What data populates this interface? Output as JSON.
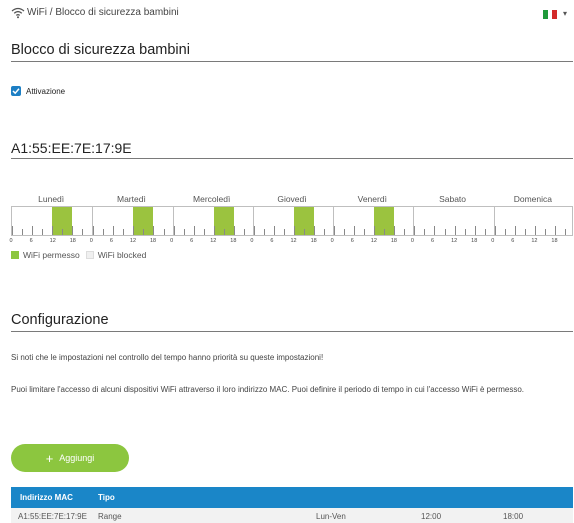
{
  "breadcrumb": {
    "wifi": "WiFi",
    "separator": "/",
    "page": "Blocco di sicurezza bambini"
  },
  "language": {
    "icon": "italy-flag-icon",
    "caret": "▾"
  },
  "section_title": "Blocco di sicurezza bambini",
  "activation": {
    "label": "Attivazione",
    "checked": true
  },
  "device": {
    "mac": "A1:55:EE:7E:17:9E"
  },
  "schedule": {
    "days": [
      "Lunedì",
      "Martedì",
      "Mercoledì",
      "Giovedì",
      "Venerdì",
      "Sabato",
      "Domenica"
    ],
    "hour_ticks": [
      "0",
      "6",
      "12",
      "18"
    ],
    "allowed": [
      {
        "day": "Lunedì",
        "from": 12,
        "to": 18
      },
      {
        "day": "Martedì",
        "from": 12,
        "to": 18
      },
      {
        "day": "Mercoledì",
        "from": 12,
        "to": 18
      },
      {
        "day": "Giovedì",
        "from": 12,
        "to": 18
      },
      {
        "day": "Venerdì",
        "from": 12,
        "to": 18
      }
    ],
    "colors": {
      "allowed": "#9bc33f",
      "blocked": "#ffffff"
    }
  },
  "legend": {
    "allowed": "WiFi permesso",
    "blocked": "WiFi blocked"
  },
  "config": {
    "title": "Configurazione",
    "note1": "Si noti che le impostazioni nel controllo del tempo hanno priorità su queste impostazioni!",
    "note2": "Puoi limitare l'accesso di alcuni dispositivi WiFi attraverso il loro indirizzo MAC. Puoi definire il periodo di tempo in cui l'accesso WiFi è permesso."
  },
  "add_button": {
    "label": "Aggiungi",
    "icon": "plus-icon"
  },
  "table": {
    "headers": [
      "Indirizzo MAC",
      "Tipo"
    ],
    "rows": [
      {
        "mac": "A1:55:EE:7E:17:9E",
        "type": "Range",
        "days": "Lun-Ven",
        "from": "12:00",
        "to": "18:00"
      }
    ]
  },
  "colors": {
    "accent": "#1a86c8",
    "green": "#8cc63f"
  }
}
